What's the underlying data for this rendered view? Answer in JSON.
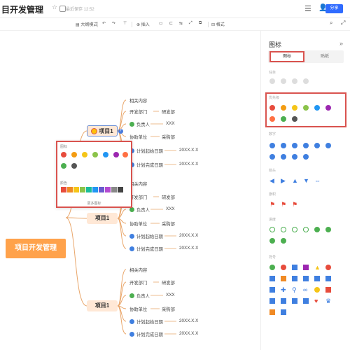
{
  "header": {
    "title": "目开发管理",
    "save_status": "最近保存 12:52",
    "share_label": "分享"
  },
  "toolbar": {
    "outline_label": "大纲模式",
    "insert_label": "插入",
    "style_label": "格式"
  },
  "mindmap": {
    "root": "项目开发管理",
    "branches": [
      {
        "title": "项目1",
        "items": [
          "相关内容",
          "开发部门",
          "负责人",
          "协助单位",
          "计划起始日期",
          "计划完成日期"
        ],
        "values": [
          "研发部",
          "XXX",
          "采购部",
          "20XX.X.X",
          "20XX.X.X"
        ]
      },
      {
        "title": "项目1",
        "items": [
          "相关内容",
          "开发部门",
          "负责人",
          "协助单位",
          "计划起始日期",
          "计划完成日期"
        ],
        "values": [
          "研发部",
          "XXX",
          "采购部",
          "20XX.X.X",
          "20XX.X.X"
        ]
      },
      {
        "title": "项目1",
        "items": [
          "相关内容",
          "开发部门",
          "负责人",
          "协助单位",
          "计划起始日期",
          "计划完成日期"
        ],
        "values": [
          "研发部",
          "XXX",
          "采购部",
          "20XX.X.X",
          "20XX.X.X"
        ]
      }
    ]
  },
  "popup": {
    "icons_label": "图标",
    "colors_label": "颜色",
    "more_label": "更多图标"
  },
  "panel": {
    "title": "图标",
    "tabs": [
      "图标",
      "贴纸"
    ],
    "sections": [
      "任务",
      "优先级",
      "数字",
      "箭头",
      "旗帜",
      "进度",
      "符号"
    ]
  },
  "colors": {
    "root": "#ffa24b",
    "topic": "#ffe8d6",
    "highlight": "#d9534f",
    "link": "#e9a66a",
    "primary": "#2f6bff"
  }
}
